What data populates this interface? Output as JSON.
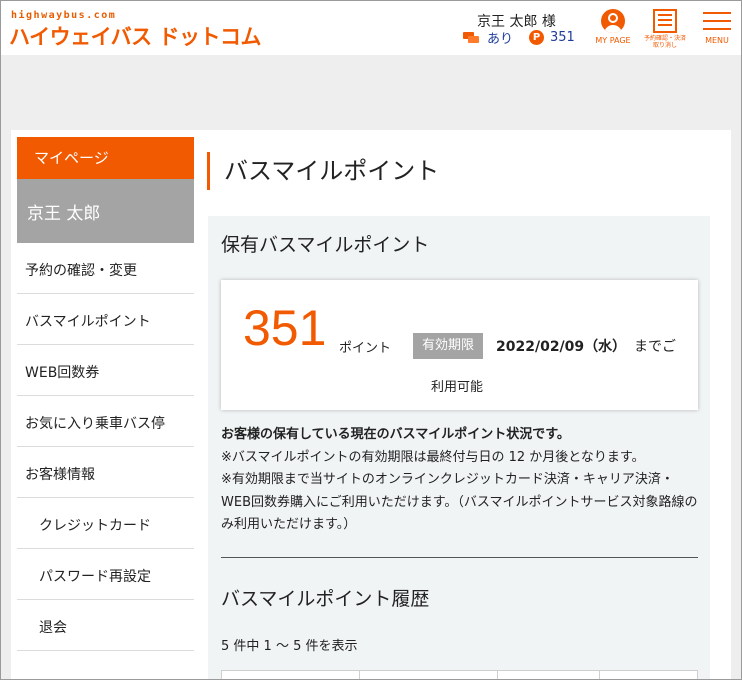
{
  "header": {
    "logo_sub": "highwaybus.com",
    "logo_main": "ハイウェイバス ドットコム",
    "user_name": "京王 太郎 様",
    "ticket_status": "あり",
    "points": "351",
    "mypage_label": "MY PAGE",
    "reserve_label_1": "予約確認・決済",
    "reserve_label_2": "取り消し",
    "menu_label": "MENU"
  },
  "sidebar": {
    "title": "マイページ",
    "user": "京王 太郎",
    "items": [
      {
        "label": "予約の確認・変更"
      },
      {
        "label": "バスマイルポイント"
      },
      {
        "label": "WEB回数券"
      },
      {
        "label": "お気に入り乗車バス停"
      },
      {
        "label": "お客様情報"
      },
      {
        "label": "クレジットカード"
      },
      {
        "label": "パスワード再設定"
      },
      {
        "label": "退会"
      }
    ]
  },
  "main": {
    "page_title": "バスマイルポイント",
    "held_heading": "保有バスマイルポイント",
    "point_value": "351",
    "point_unit": "ポイント",
    "expiry_badge": "有効期限",
    "expiry_date": "2022/02/09（水）",
    "expiry_suffix": "までご",
    "usable": "利用可能",
    "notice_bold": "お客様の保有している現在のバスマイルポイント状況です。",
    "notice_line1": "※バスマイルポイントの有効期限は最終付与日の 12 か月後となります。",
    "notice_line2": "※有効期限まで当サイトのオンラインクレジットカード決済・キャリア決済・WEB回数券購入にご利用いただけます。（バスマイルポイントサービス対象路線のみ利用いただけます。）",
    "history_heading": "バスマイルポイント履歴",
    "count_text": "5 件中 1 ～ 5 件を表示"
  }
}
